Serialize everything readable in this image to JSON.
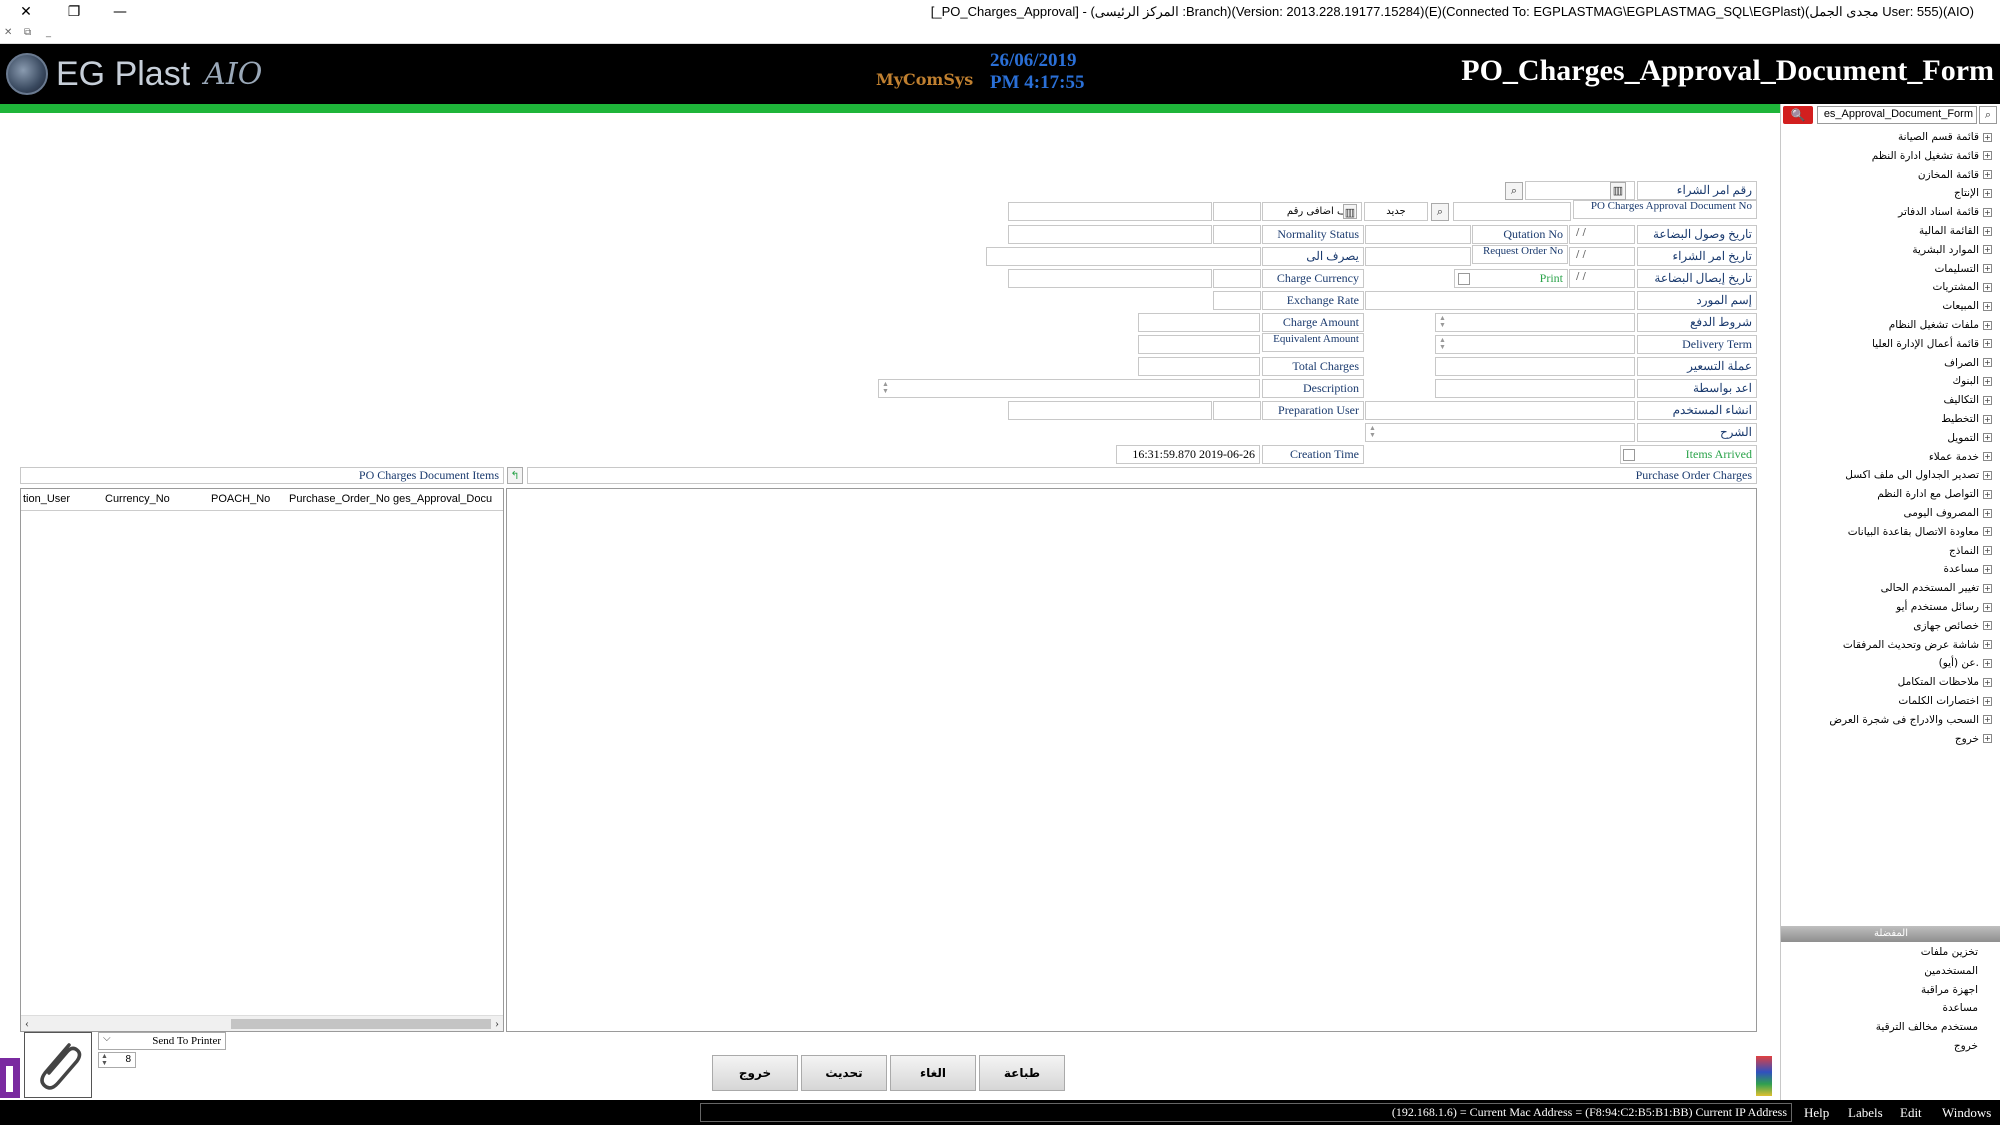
{
  "window": {
    "title": "[_PO_Charges_Approval] - (المركز الرئيسى :Branch)(Version: 2013.228.19177.15284)(E)(Connected To: EGPLASTMAG\\EGPLASTMAG_SQL\\EGPlast)(مجدى الجمل User: 555)(AIO)"
  },
  "header": {
    "brand": "EG Plast",
    "aio": "AIO",
    "partner": "MyComSys",
    "date": "26/06/2019",
    "time": "PM 4:17:55",
    "form_title": "PO_Charges_Approval_Document_Form"
  },
  "sidebar": {
    "search_value": "es_Approval_Document_Form",
    "items": [
      "قائمة قسم الصيانة",
      "قائمة تشغيل ادارة النظم",
      "قائمة المخازن",
      "الإنتاج",
      "قائمة اسناد الدفاتر",
      "القائمة المالية",
      "الموارد البشرية",
      "التسليمات",
      "المشتريات",
      "المبيعات",
      "ملفات تشغيل النظام",
      "قائمة أعمال الإدارة العليا",
      "الصراف",
      "البنوك",
      "التكاليف",
      "التخطيط",
      "التمويل",
      "خدمة عملاء",
      "تصدير الجداول الى ملف اكسل",
      "التواصل مع ادارة النظم",
      "المصروف اليومى",
      "معاودة الاتصال بقاعدة البيانات",
      "النماذج",
      "مساعدة",
      "تغيير المستخدم الحالى",
      "رسائل مستخدم أيو",
      "خصائص جهازى",
      "شاشة عرض وتحديث المرفقات",
      "عن (أيو).",
      "ملاحظات المتكامل",
      "اختصارات الكلمات",
      "السحب والادراج فى شجرة العرض",
      "خروج"
    ],
    "favorites_title": "المفضلة",
    "favorites": [
      "تخزين ملفات",
      "المستخدمين",
      "اجهزة مراقبة",
      "مساعدة",
      "مستخدم مخالف الترقية",
      "خروج"
    ]
  },
  "form": {
    "po_no_label": "رقم امر الشراء",
    "doc_no_label": "PO Charges Approval Document No",
    "new_label": "جديد",
    "extra_label": "روف اضافى رقم",
    "normality_label": "Normality Status",
    "arrival_date_label": "تاريخ وصول البضاعة",
    "quotation_label": "Qutation No",
    "po_date_label": "تاريخ امر الشراء",
    "request_order_label": "Request Order No",
    "spend_to_label": "يصرف الى",
    "receipt_date_label": "تاريخ إيصال البضاعة",
    "print_label": "Print",
    "charge_currency_label": "Charge Currency",
    "supplier_label": "إسم المورد",
    "exchange_rate_label": "Exchange Rate",
    "payment_terms_label": "شروط الدفع",
    "charge_amount_label": "Charge Amount",
    "delivery_term_label": "Delivery Term",
    "equivalent_label": "Equivalent Amount",
    "pricing_currency_label": "عملة التسعير",
    "total_charges_label": "Total Charges",
    "prepared_by_label": "اعد بواسطة",
    "description_label": "Description",
    "creator_label": "انشاء المستخدم",
    "prep_user_label": "Preparation User",
    "explanation_label": "الشرح",
    "creation_time_label": "Creation Time",
    "creation_time_value": "16:31:59.870 2019-06-26",
    "items_arrived_label": "Items Arrived",
    "date_placeholder": "/ /"
  },
  "grids": {
    "items_title": "PO Charges Document Items",
    "charges_title": "Purchase Order Charges",
    "items_columns": [
      "tion_User",
      "Currency_No",
      "POACH_No",
      "Purchase_Order_No",
      "ges_Approval_Docu"
    ]
  },
  "bottom": {
    "printer_label": "Send To Printer",
    "copies": "8",
    "buttons": [
      "طباعة",
      "الغاء",
      "تحديث",
      "خروج"
    ]
  },
  "status": {
    "info": "(192.168.1.6) = Current Mac Address = (F8:94:C2:B5:B1:BB) Current IP Address",
    "menu": [
      "Help",
      "Labels",
      "Edit",
      "Windows"
    ]
  }
}
